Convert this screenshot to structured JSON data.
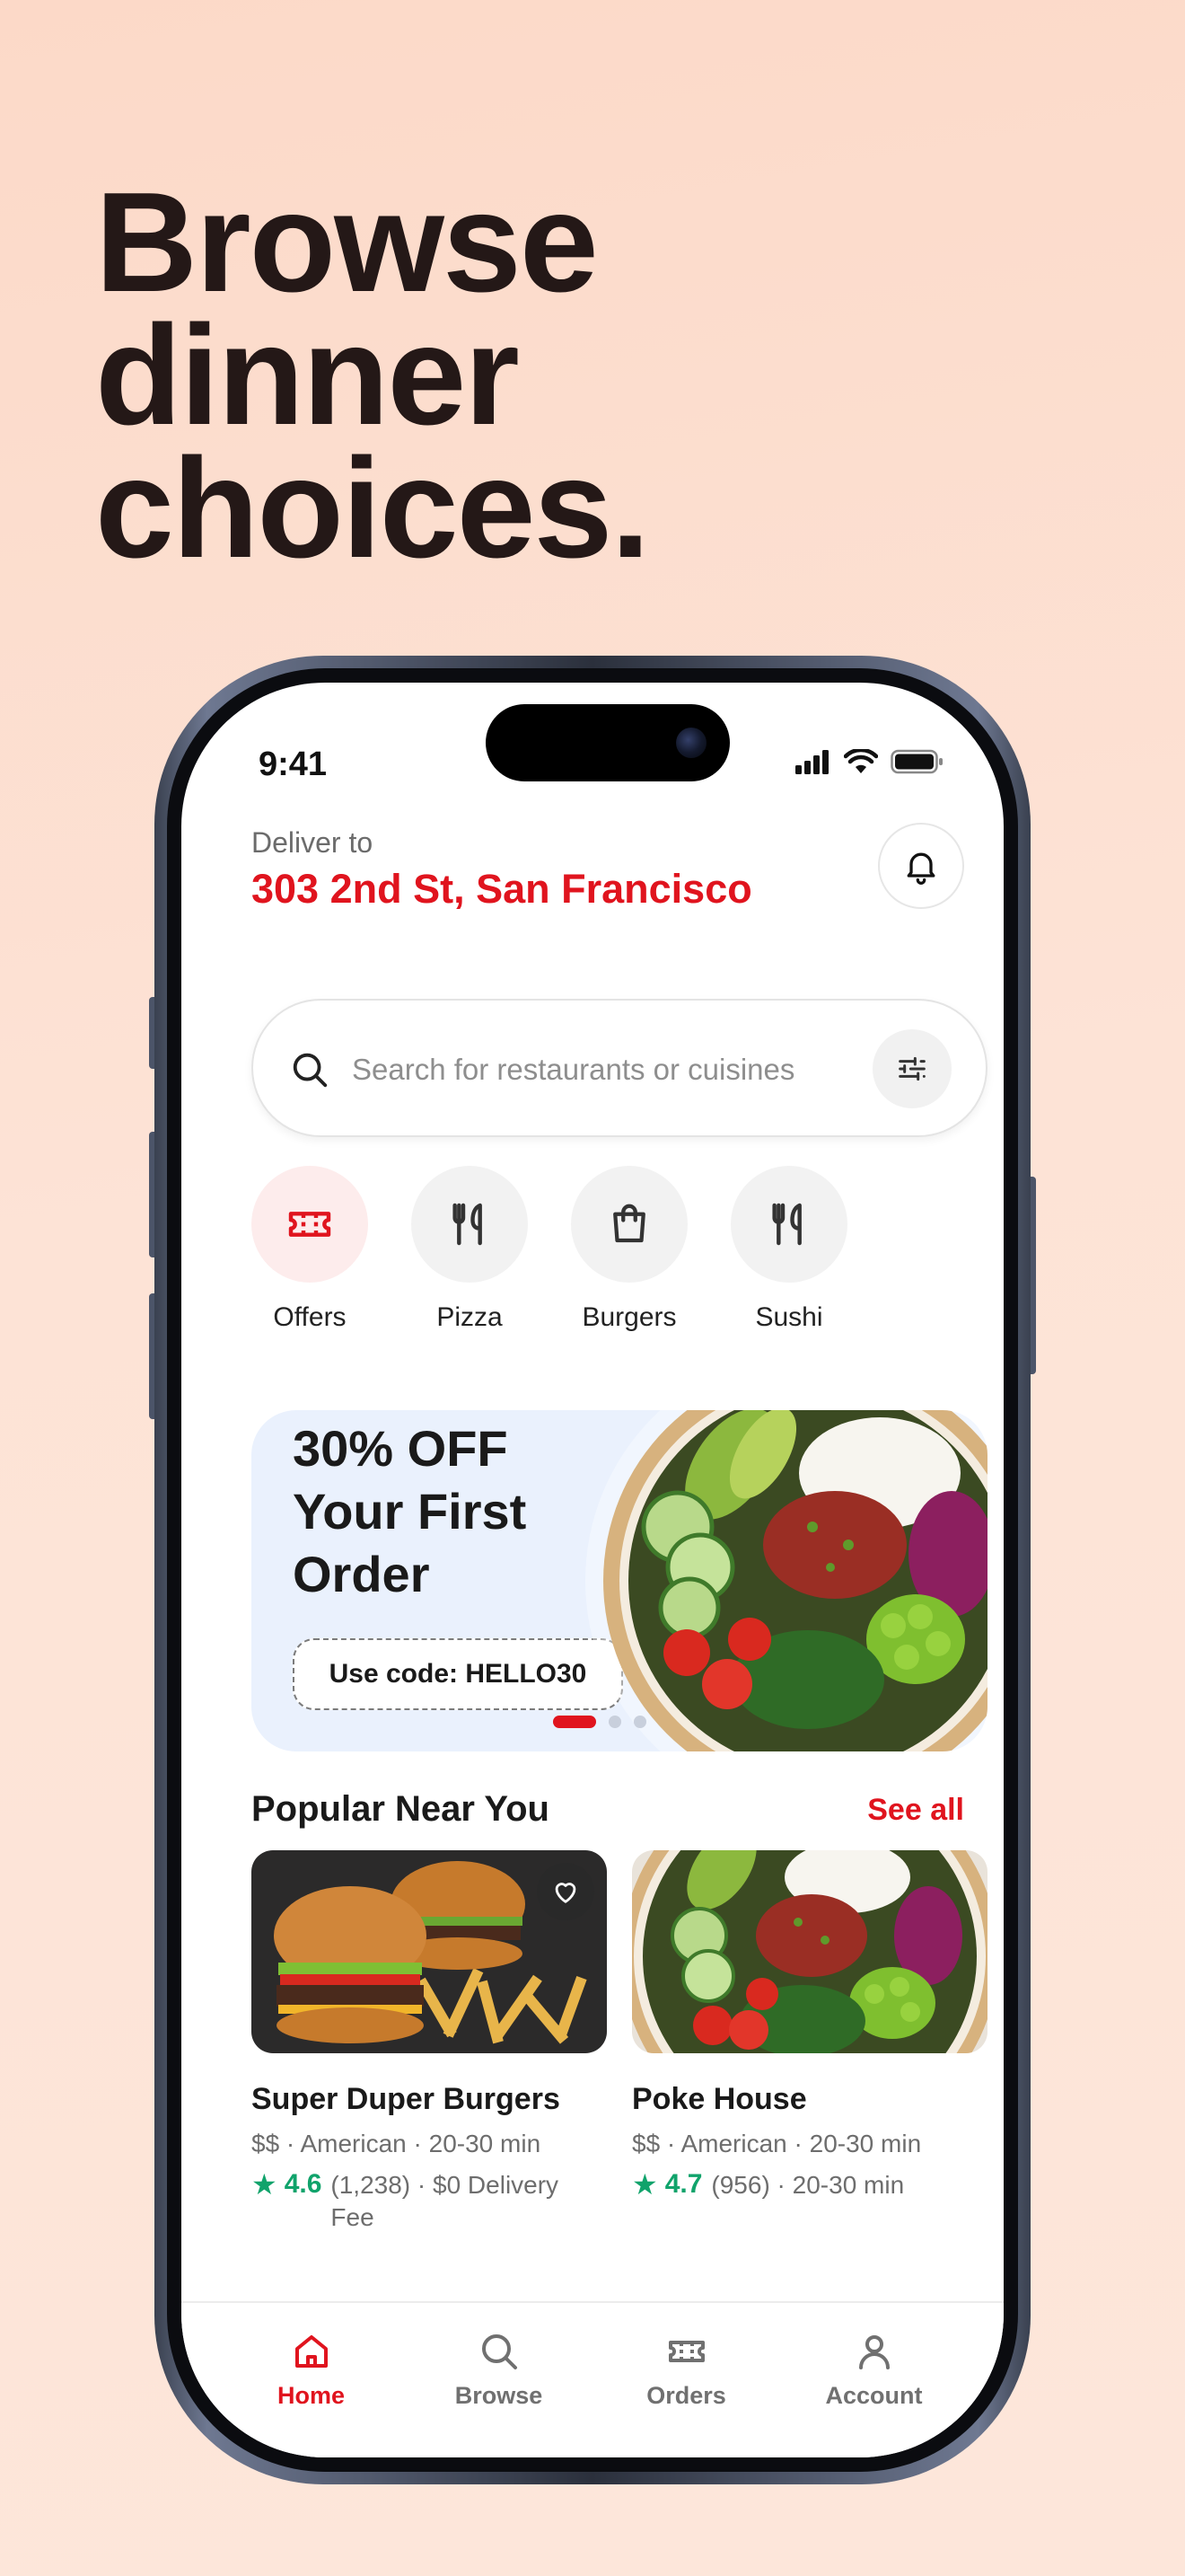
{
  "headline": {
    "line1": "Browse",
    "line2": "dinner",
    "line3": "choices."
  },
  "status_bar": {
    "time": "9:41"
  },
  "header": {
    "deliver_label": "Deliver to",
    "address": "303 2nd St, San Francisco"
  },
  "search": {
    "placeholder": "Search for restaurants or cuisines",
    "value": ""
  },
  "categories": [
    {
      "label": "Offers",
      "icon": "ticket-icon"
    },
    {
      "label": "Pizza",
      "icon": "utensils-icon"
    },
    {
      "label": "Burgers",
      "icon": "shopping-bag-icon"
    },
    {
      "label": "Sushi",
      "icon": "utensils-icon"
    }
  ],
  "promo": {
    "title": "30% OFF Your First Order",
    "code_label": "Use code: HELLO30",
    "active_slide": 1,
    "slide_count": 3
  },
  "popular": {
    "title": "Popular Near You",
    "see_all": "See all",
    "items": [
      {
        "name": "Super Duper Burgers",
        "meta": "$$ · American · 20-30 min",
        "rating": "4.6",
        "extra": "(1,238) · $0 Delivery Fee"
      },
      {
        "name": "Poke House",
        "meta": "$$ · American · 20-30 min",
        "rating": "4.7",
        "extra": "(956) · 20-30 min"
      }
    ]
  },
  "tabbar": {
    "items": [
      {
        "label": "Home",
        "icon": "home-icon",
        "active": true
      },
      {
        "label": "Browse",
        "icon": "search-icon",
        "active": false
      },
      {
        "label": "Orders",
        "icon": "ticket-icon",
        "active": false
      },
      {
        "label": "Account",
        "icon": "user-icon",
        "active": false
      }
    ]
  },
  "colors": {
    "accent": "#e0141e",
    "rating": "#10a36b",
    "background": "#fde3d6",
    "promo_bg": "#eaf1fd"
  }
}
